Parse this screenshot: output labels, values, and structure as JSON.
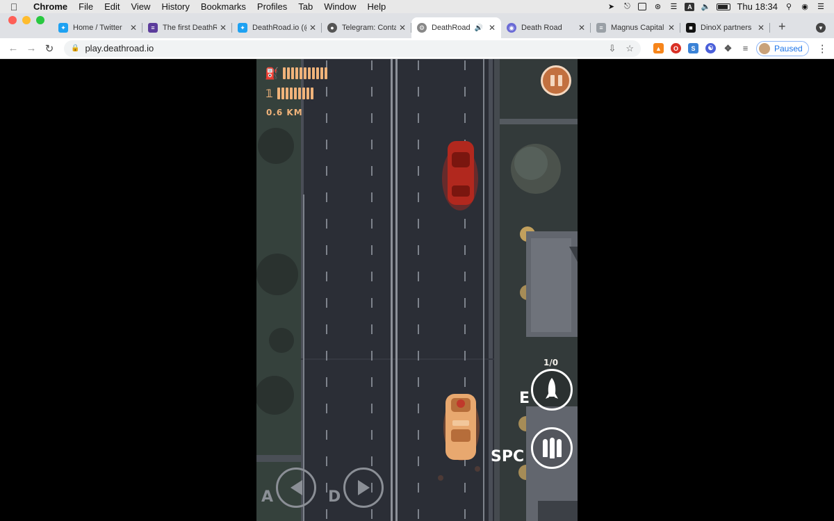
{
  "menubar": {
    "app": "Chrome",
    "items": [
      "File",
      "Edit",
      "View",
      "History",
      "Bookmarks",
      "Profiles",
      "Tab",
      "Window",
      "Help"
    ],
    "clock": "Thu 18:34",
    "keyboard_layout": "A"
  },
  "tabs": [
    {
      "title": "Home / Twitter",
      "icon": "twitter-icon",
      "color": "#1da1f2"
    },
    {
      "title": "The first DeathR",
      "icon": "list-icon",
      "color": "#5c3c9c"
    },
    {
      "title": "DeathRoad.io (@",
      "icon": "twitter-icon",
      "color": "#1da1f2"
    },
    {
      "title": "Telegram: Conta",
      "icon": "globe-icon",
      "color": "#555555"
    },
    {
      "title": "DeathRoad",
      "icon": "gear-icon",
      "color": "#888888",
      "active": true,
      "audio": true
    },
    {
      "title": "Death Road",
      "icon": "deathroad-icon",
      "color": "#6b6bd6"
    },
    {
      "title": "Magnus Capital",
      "icon": "magnus-icon",
      "color": "#9aa0a6"
    },
    {
      "title": "DinoX partners",
      "icon": "dinox-icon",
      "color": "#111111"
    }
  ],
  "toolbar": {
    "url": "play.deathroad.io",
    "profile_status": "Paused"
  },
  "game": {
    "distance": "0.6 KM",
    "fuel_level": 1.0,
    "health_level": 1.0,
    "rocket_count": "1/0",
    "rocket_key": "E",
    "fire_key": "SPC",
    "left_key": "A",
    "right_key": "D"
  },
  "colors": {
    "hud": "#f0b37a",
    "road": "#2b2e36",
    "player_car": "#e8a86f",
    "enemy_car": "#b1281e"
  }
}
